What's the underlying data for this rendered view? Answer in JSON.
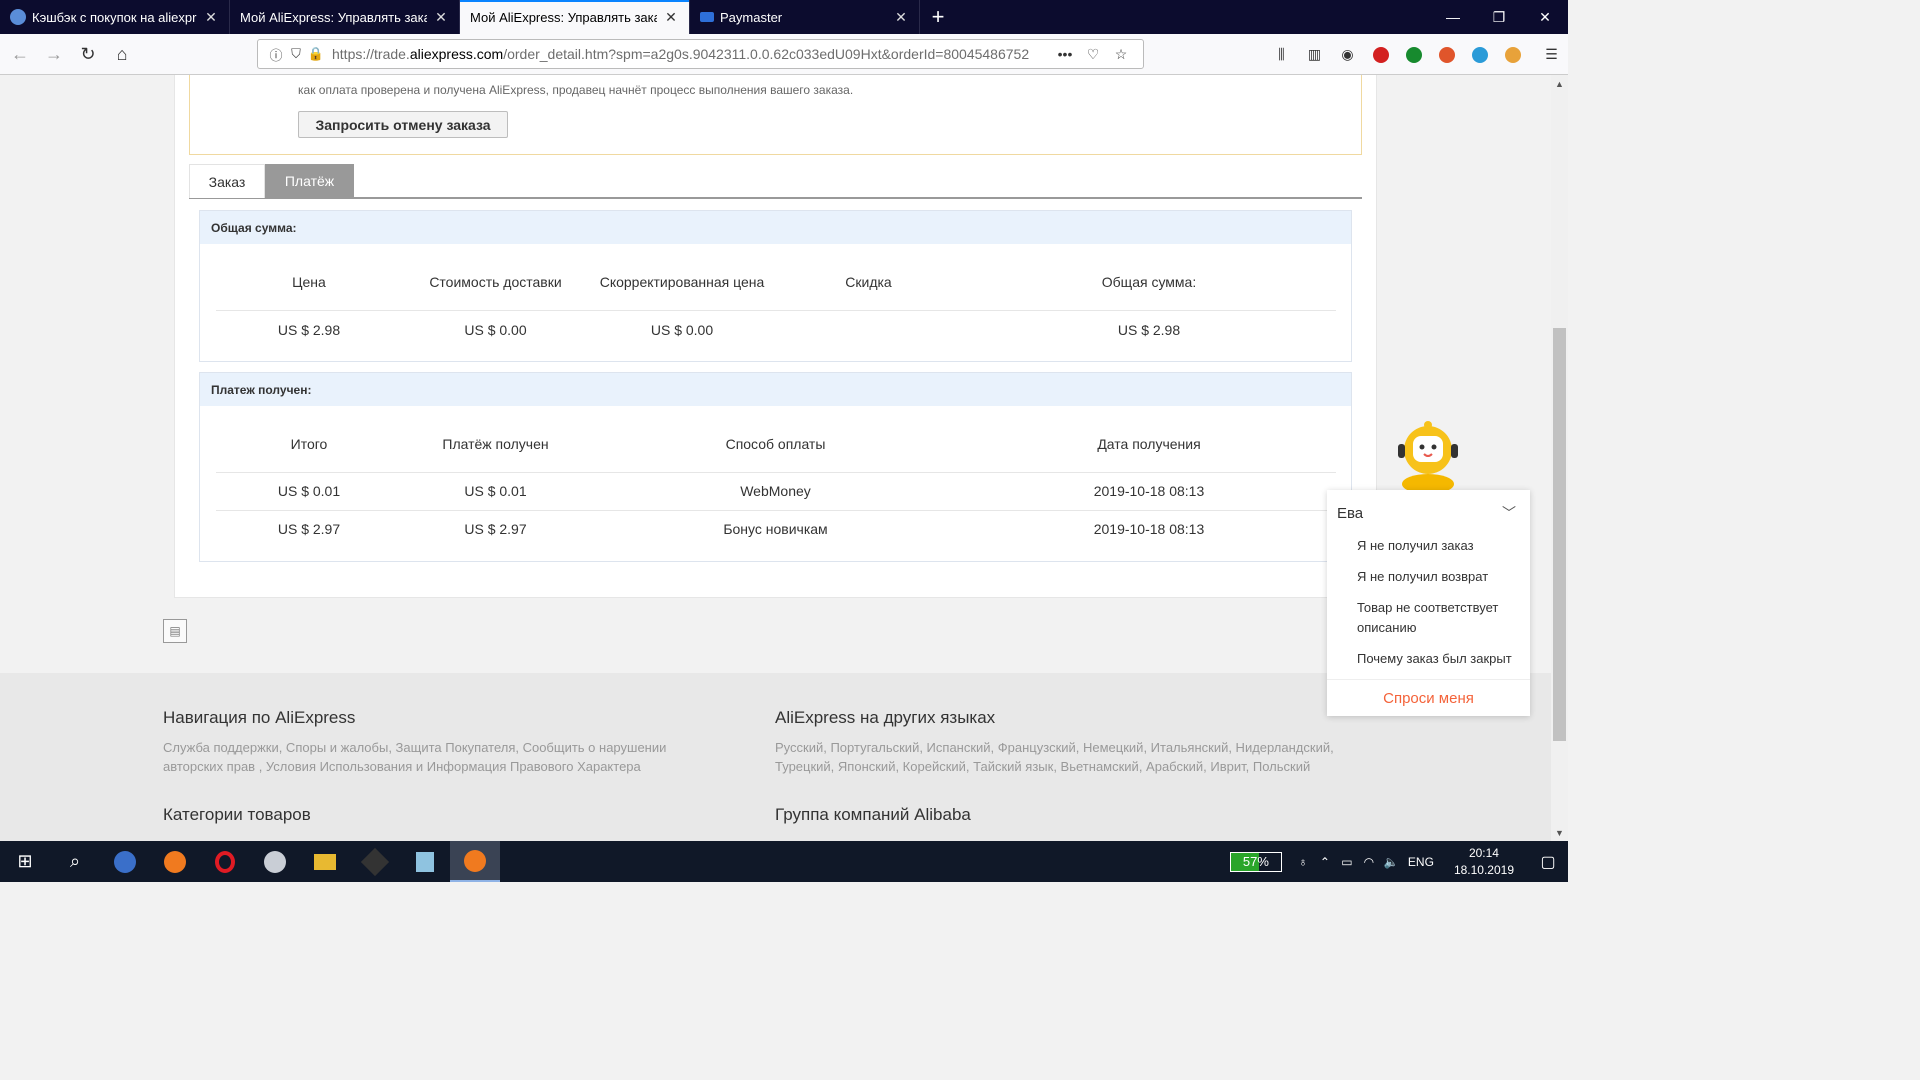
{
  "browser": {
    "tabs": [
      {
        "title": "Кэшбэк с покупок на aliexpress",
        "favicon_color": "#5a8dd8",
        "active": false
      },
      {
        "title": "Мой AliExpress: Управлять заказами",
        "favicon_color": "",
        "active": false
      },
      {
        "title": "Мой AliExpress: Управлять заказами",
        "favicon_color": "",
        "active": true
      },
      {
        "title": "Paymaster",
        "favicon_color": "#2e6fd8",
        "active": false
      }
    ],
    "url_prefix": "https://trade.",
    "url_domain": "aliexpress.com",
    "url_rest": "/order_detail.htm?spm=a2g0s.9042311.0.0.62c033edU09Hxt&orderId=80045486752"
  },
  "notice": {
    "text": "как оплата проверена и получена AliExpress, продавец начнёт процесс выполнения вашего заказа.",
    "cancel_button": "Запросить отмену заказа"
  },
  "tabs": {
    "order": "Заказ",
    "payment": "Платёж"
  },
  "total_box": {
    "header": "Общая сумма:",
    "columns": [
      "Цена",
      "Стоимость доставки",
      "Скорректированная цена",
      "Скидка",
      "Общая сумма:"
    ],
    "row": [
      "US $ 2.98",
      "US $ 0.00",
      "US $ 0.00",
      "",
      "US $ 2.98"
    ]
  },
  "payment_box": {
    "header": "Платеж получен:",
    "columns": [
      "Итого",
      "Платёж получен",
      "Способ оплаты",
      "Дата получения"
    ],
    "rows": [
      [
        "US $ 0.01",
        "US $ 0.01",
        "WebMoney",
        "2019-10-18 08:13"
      ],
      [
        "US $ 2.97",
        "US $ 2.97",
        "Бонус новичкам",
        "2019-10-18 08:13"
      ]
    ]
  },
  "footer": {
    "nav_title": "Навигация по AliExpress",
    "nav_links": "Служба поддержки, Споры и жалобы, Защита Покупателя, Сообщить о нарушении авторских прав , Условия Использования и Информация Правового Характера",
    "lang_title": "AliExpress на других языках",
    "lang_links": "Русский, Португальский, Испанский, Французский, Немецкий, Итальянский, Нидерландский, Турецкий, Японский, Корейский, Тайский язык, Вьетнамский, Арабский, Иврит, Польский",
    "cat_title": "Категории товаров",
    "group_title": "Группа компаний Alibaba"
  },
  "chat": {
    "name": "Ева",
    "items": [
      "Я не получил заказ",
      "Я не получил возврат",
      "Товар не соответствует описанию",
      "Почему заказ был закрыт"
    ],
    "ask": "Спроси меня"
  },
  "taskbar": {
    "battery": "57%",
    "battery_level": 0.57,
    "lang": "ENG",
    "time": "20:14",
    "date": "18.10.2019"
  }
}
